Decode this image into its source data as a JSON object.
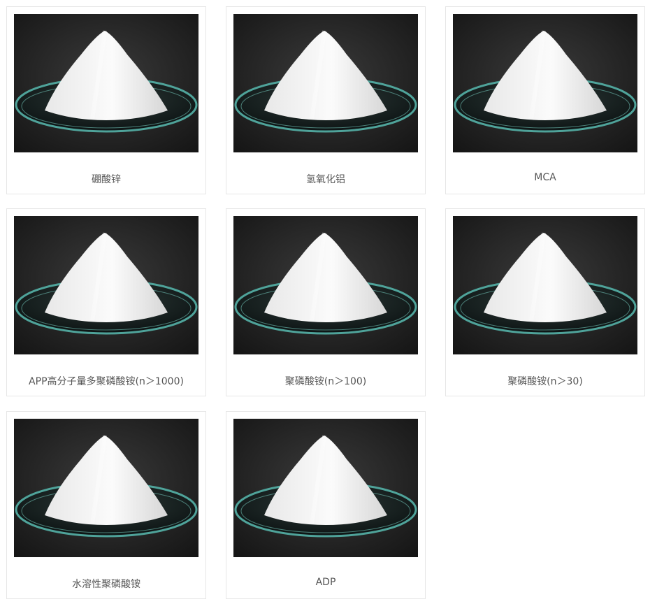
{
  "products": [
    {
      "name": "硼酸锌",
      "image": "white-powder-on-watch-glass"
    },
    {
      "name": "氢氧化铝",
      "image": "white-powder-on-watch-glass"
    },
    {
      "name": "MCA",
      "image": "white-powder-on-watch-glass"
    },
    {
      "name": "APP高分子量多聚磷酸铵(n＞1000)",
      "image": "white-powder-on-watch-glass"
    },
    {
      "name": "聚磷酸铵(n＞100)",
      "image": "white-powder-on-watch-glass"
    },
    {
      "name": "聚磷酸铵(n＞30)",
      "image": "white-powder-on-watch-glass"
    },
    {
      "name": "水溶性聚磷酸铵",
      "image": "white-powder-on-watch-glass"
    },
    {
      "name": "ADP",
      "image": "white-powder-on-watch-glass"
    }
  ],
  "colors": {
    "card_border": "#e6e6e6",
    "caption_text": "#555555",
    "photo_background": "#1c1c1c"
  }
}
